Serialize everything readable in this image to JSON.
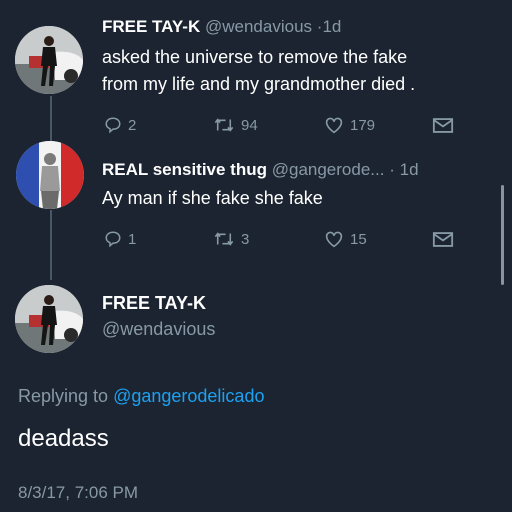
{
  "colors": {
    "background": "#1b2430",
    "secondary_text": "#8899a6",
    "link": "#1da1f2"
  },
  "tweet1": {
    "display_name": "FREE TAY-K",
    "handle": "@wendavious",
    "separator": "·",
    "time": "1d",
    "text_line1": "asked the universe to remove the fake",
    "text_line2": "from my life and my grandmother died .",
    "reply_count": "2",
    "retweet_count": "94",
    "like_count": "179",
    "icons": [
      "reply-icon",
      "retweet-icon",
      "like-icon",
      "dm-icon"
    ]
  },
  "tweet2": {
    "display_name": "REAL sensitive thug",
    "handle": "@gangerode...",
    "separator": "·",
    "time": "1d",
    "text": "Ay man if she fake she fake",
    "reply_count": "1",
    "retweet_count": "3",
    "like_count": "15",
    "icons": [
      "reply-icon",
      "retweet-icon",
      "like-icon",
      "dm-icon"
    ]
  },
  "main_tweet": {
    "display_name": "FREE TAY-K",
    "handle": "@wendavious",
    "replying_prefix": "Replying to",
    "replying_mention": "@gangerodelicado",
    "text": "deadass",
    "timestamp": "8/3/17, 7:06 PM"
  }
}
